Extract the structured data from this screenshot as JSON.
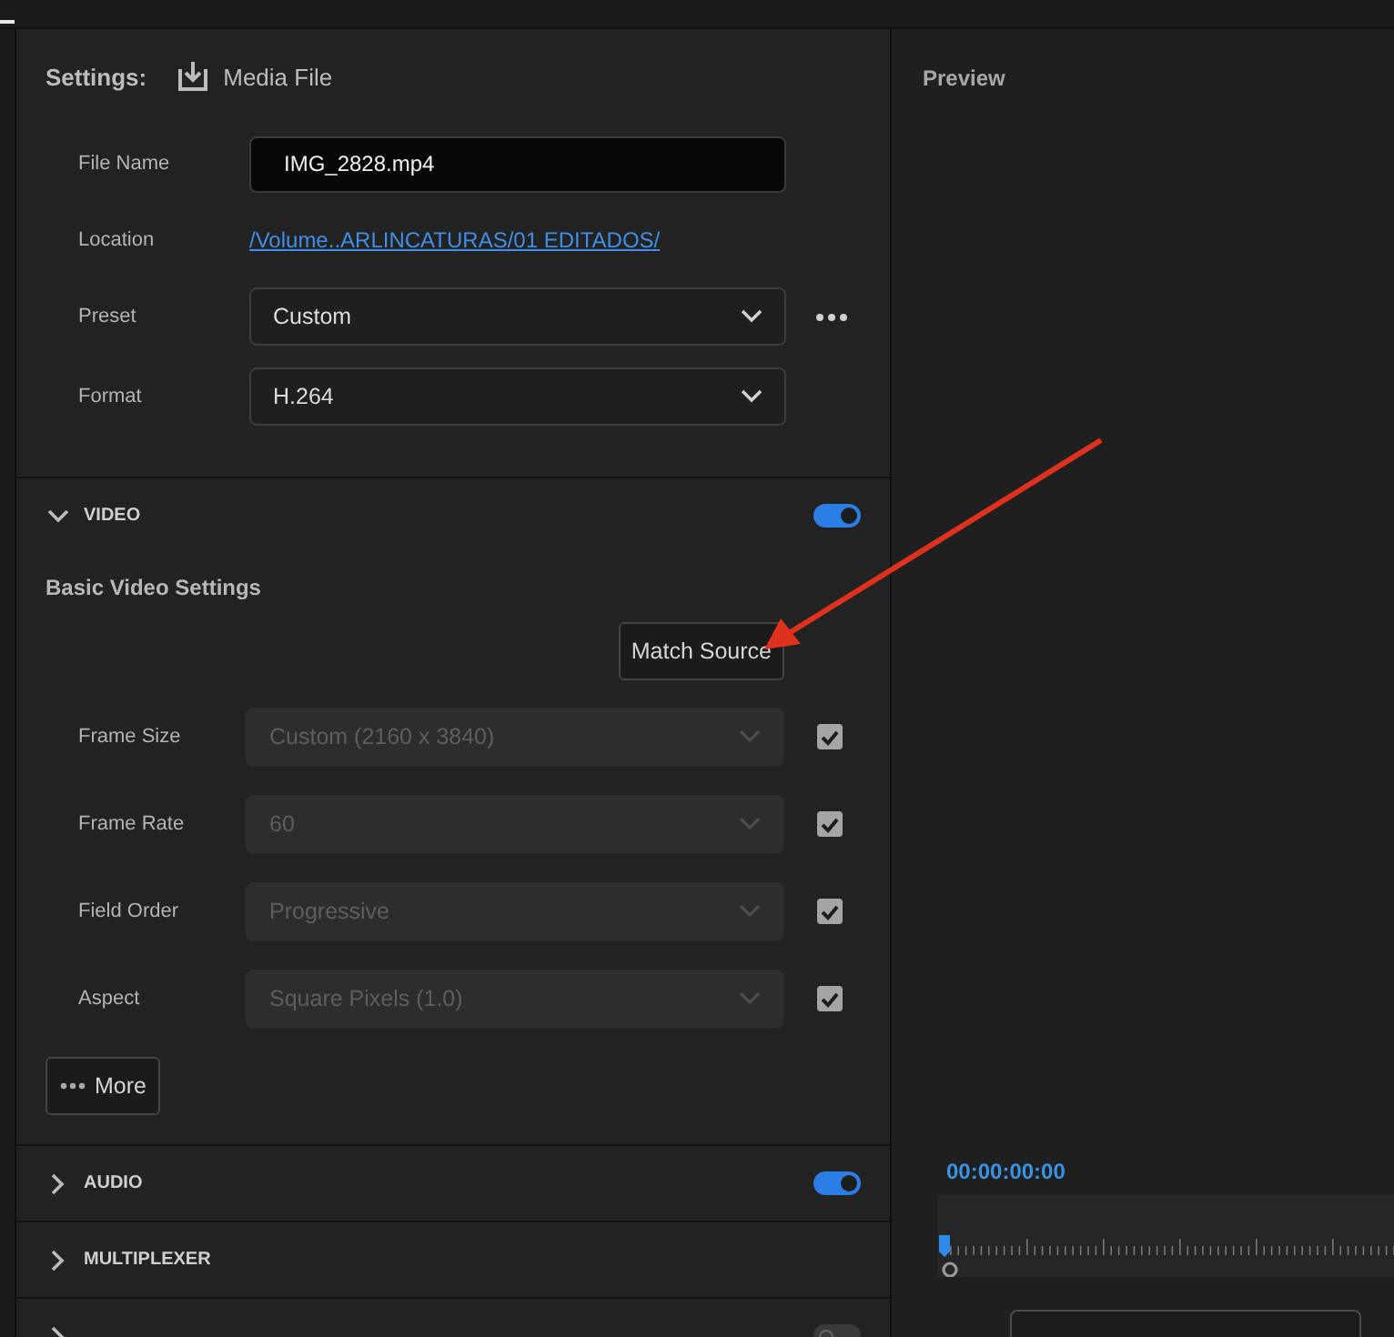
{
  "settings": {
    "label": "Settings:",
    "target": "Media File"
  },
  "fields": [
    {
      "kind": "input",
      "label": "File Name",
      "value": "IMG_2828.mp4"
    },
    {
      "kind": "link",
      "label": "Location",
      "value": "/Volume..ARLINCATURAS/01 EDITADOS/"
    },
    {
      "kind": "select",
      "label": "Preset",
      "value": "Custom",
      "has_more": true
    },
    {
      "kind": "select",
      "label": "Format",
      "value": "H.264",
      "has_more": false
    }
  ],
  "video": {
    "title": "VIDEO",
    "expanded": true,
    "on": true,
    "subheading": "Basic Video Settings",
    "match_button": "Match Source",
    "settings": [
      {
        "label": "Frame Size",
        "value": "Custom (2160 x 3840)",
        "disabled": true,
        "checked": true
      },
      {
        "label": "Frame Rate",
        "value": "60",
        "disabled": true,
        "checked": true
      },
      {
        "label": "Field Order",
        "value": "Progressive",
        "disabled": true,
        "checked": true
      },
      {
        "label": "Aspect",
        "value": "Square Pixels (1.0)",
        "disabled": true,
        "checked": true
      }
    ],
    "more_button": "More"
  },
  "sections": [
    {
      "kind": "toggle",
      "title": "AUDIO",
      "expanded": false,
      "on": true
    },
    {
      "kind": "plain",
      "title": "MULTIPLEXER",
      "expanded": false
    },
    {
      "kind": "toggle",
      "expanded": false,
      "on": false
    }
  ],
  "preview": {
    "title": "Preview",
    "timecode": "00:00:00:00"
  }
}
